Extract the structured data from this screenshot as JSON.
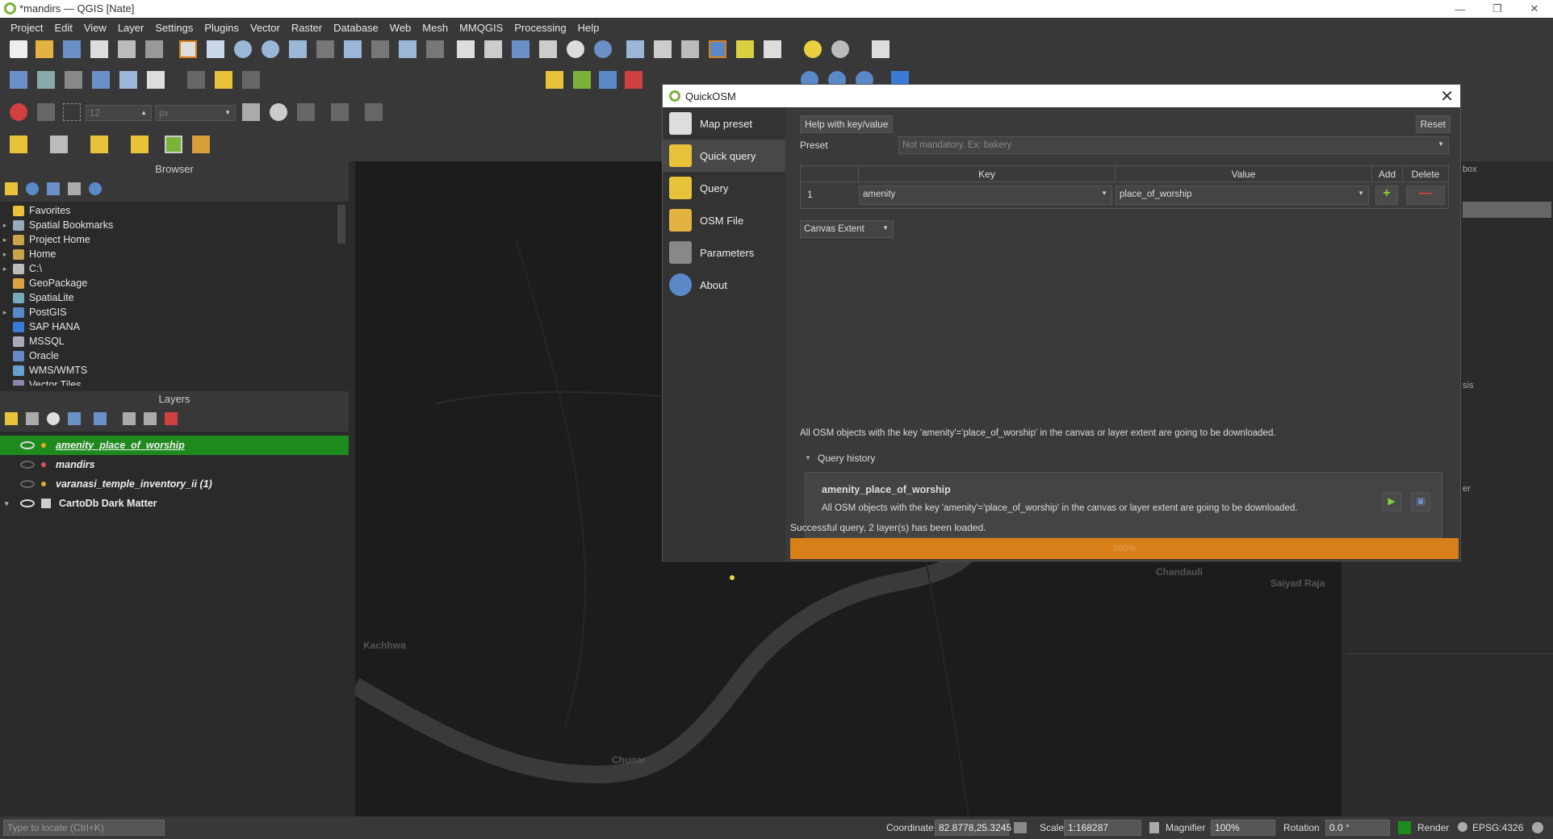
{
  "window": {
    "title": "*mandirs — QGIS [Nate]"
  },
  "menu": [
    "Project",
    "Edit",
    "View",
    "Layer",
    "Settings",
    "Plugins",
    "Vector",
    "Raster",
    "Database",
    "Web",
    "Mesh",
    "MMQGIS",
    "Processing",
    "Help"
  ],
  "snapping": {
    "tolerance": "12",
    "unit": "px"
  },
  "browser": {
    "title": "Browser",
    "items": [
      {
        "label": "Favorites",
        "icon": "star-icon",
        "color": "#e8c33a",
        "arrow": false
      },
      {
        "label": "Spatial Bookmarks",
        "icon": "bookmark-icon",
        "color": "#9ab",
        "arrow": true
      },
      {
        "label": "Project Home",
        "icon": "folder-icon",
        "color": "#c9a34a",
        "arrow": true
      },
      {
        "label": "Home",
        "icon": "folder-icon",
        "color": "#c9a34a",
        "arrow": true
      },
      {
        "label": "C:\\",
        "icon": "drive-icon",
        "color": "#bbb",
        "arrow": true
      },
      {
        "label": "GeoPackage",
        "icon": "geopackage-icon",
        "color": "#d9a441",
        "arrow": false
      },
      {
        "label": "SpatiaLite",
        "icon": "spatialite-icon",
        "color": "#7ab",
        "arrow": false
      },
      {
        "label": "PostGIS",
        "icon": "postgis-icon",
        "color": "#5b88c7",
        "arrow": true
      },
      {
        "label": "SAP HANA",
        "icon": "saphana-icon",
        "color": "#3a7bd5",
        "arrow": false
      },
      {
        "label": "MSSQL",
        "icon": "mssql-icon",
        "color": "#aab",
        "arrow": false
      },
      {
        "label": "Oracle",
        "icon": "oracle-icon",
        "color": "#6a8ac7",
        "arrow": false
      },
      {
        "label": "WMS/WMTS",
        "icon": "wms-icon",
        "color": "#6aa0d0",
        "arrow": false
      },
      {
        "label": "Vector Tiles",
        "icon": "vectortiles-icon",
        "color": "#88a",
        "arrow": false
      }
    ]
  },
  "layers": {
    "title": "Layers",
    "items": [
      {
        "label": "amenity_place_of_worship",
        "selected": true,
        "visible": true,
        "dot": "#e0b020"
      },
      {
        "label": "mandirs",
        "selected": false,
        "visible": false,
        "dot": "#e05060"
      },
      {
        "label": "varanasi_temple_inventory_ii (1)",
        "selected": false,
        "visible": false,
        "dot": "#e0b020"
      },
      {
        "label": "CartoDb Dark Matter",
        "selected": false,
        "visible": true,
        "dot": ""
      }
    ]
  },
  "map": {
    "labels": [
      "Kachhwa",
      "Chunar",
      "Chandauli",
      "Saiyad Raja"
    ]
  },
  "dock": {
    "frag1": "box",
    "frag2": "sis",
    "frag3": "er"
  },
  "dialog": {
    "title": "QuickOSM",
    "nav": [
      "Map preset",
      "Quick query",
      "Query",
      "OSM File",
      "Parameters",
      "About"
    ],
    "help_btn": "Help with key/value",
    "reset_btn": "Reset",
    "preset_label": "Preset",
    "preset_placeholder": "Not mandatory. Ex: bakery",
    "table_headers": {
      "key": "Key",
      "value": "Value",
      "add": "Add",
      "delete": "Delete"
    },
    "row": {
      "num": "1",
      "key": "amenity",
      "value": "place_of_worship"
    },
    "extent": "Canvas Extent",
    "description": "All OSM objects with the key 'amenity'='place_of_worship' in the canvas or layer extent are going to be downloaded.",
    "history_title": "Query history",
    "history_item": {
      "name": "amenity_place_of_worship",
      "desc": "All OSM objects with the key 'amenity'='place_of_worship' in the canvas or layer extent are going to be downloaded."
    },
    "status": "Successful query, 2 layer(s) has been loaded.",
    "progress": "100%"
  },
  "statusbar": {
    "locate_placeholder": "Type to locate (Ctrl+K)",
    "coordinate_label": "Coordinate",
    "coordinate": "82.8778,25.3245",
    "scale_label": "Scale",
    "scale": "1:168287",
    "magnifier_label": "Magnifier",
    "magnifier": "100%",
    "rotation_label": "Rotation",
    "rotation": "0.0 °",
    "render_label": "Render",
    "crs": "EPSG:4326"
  }
}
